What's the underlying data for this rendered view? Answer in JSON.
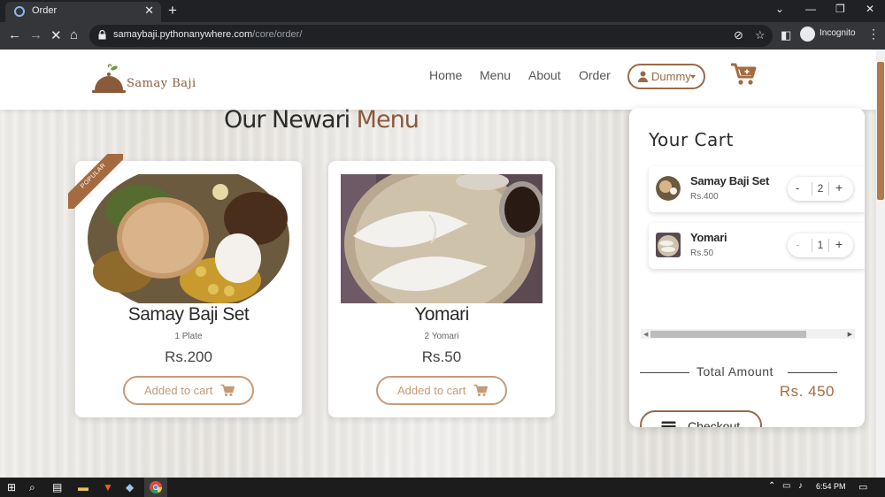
{
  "browser": {
    "tab_title": "Order",
    "tab_close": "✕",
    "new_tab": "+",
    "url_host": "samaybaji.pythonanywhere.com",
    "url_path": "/core/order/",
    "incognito_label": "Incognito",
    "window_controls": [
      "⌄",
      "—",
      "❐",
      "✕"
    ]
  },
  "site": {
    "brand": "Samay Baji",
    "nav": [
      "Home",
      "Menu",
      "About",
      "Order"
    ],
    "user_label": "Dummy"
  },
  "menu": {
    "title_part1": "Our Newari ",
    "title_part2": "Menu",
    "items": [
      {
        "name": "Samay Baji Set",
        "qty": "1 Plate",
        "price": "Rs.200",
        "button": "Added to cart",
        "badge": "POPULAR"
      },
      {
        "name": "Yomari",
        "qty": "2 Yomari",
        "price": "Rs.50",
        "button": "Added to cart"
      }
    ]
  },
  "cart": {
    "title": "Your Cart",
    "items": [
      {
        "name": "Samay Baji Set",
        "price": "Rs.400",
        "minus": "-",
        "qty": "2",
        "plus": "+"
      },
      {
        "name": "Yomari",
        "price": "Rs.50",
        "minus": "-",
        "qty": "1",
        "plus": "+"
      }
    ],
    "total_label": "Total Amount",
    "total_value": "Rs. 450",
    "checkout_label": "Checkout"
  },
  "taskbar": {
    "time": "6:54 PM"
  },
  "colors": {
    "brand_brown": "#9a6a45",
    "accent_brown": "#a56a3f",
    "chrome_dark": "#202124"
  }
}
